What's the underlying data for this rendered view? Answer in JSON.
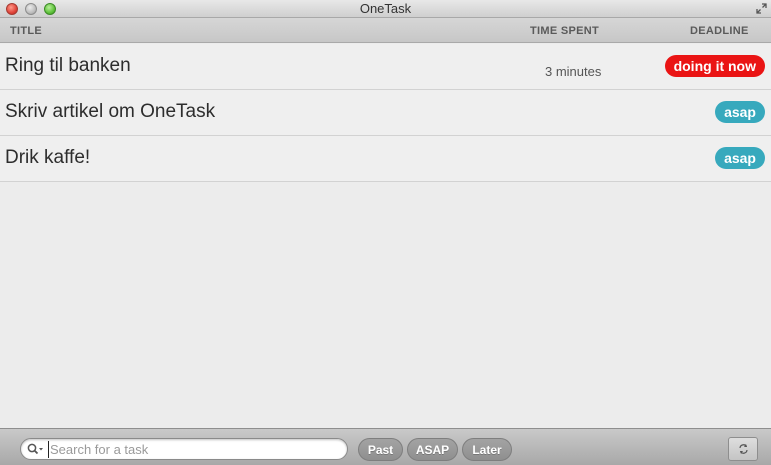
{
  "window": {
    "title": "OneTask"
  },
  "columns": {
    "title": "TITLE",
    "time_spent": "TIME SPENT",
    "deadline": "DEADLINE"
  },
  "tasks": [
    {
      "title": "Ring til banken",
      "time_spent": "3 minutes",
      "deadline": "doing it now",
      "deadline_color": "#ea1414"
    },
    {
      "title": "Skriv artikel om OneTask",
      "time_spent": "",
      "deadline": "asap",
      "deadline_color": "#37a9bd"
    },
    {
      "title": "Drik kaffe!",
      "time_spent": "",
      "deadline": "asap",
      "deadline_color": "#37a9bd"
    }
  ],
  "search": {
    "value": "",
    "placeholder": "Search for a task"
  },
  "filters": {
    "past": "Past",
    "asap": "ASAP",
    "later": "Later"
  },
  "icons": {
    "search": "search-icon",
    "sync": "sync-icon",
    "fullscreen": "fullscreen-icon"
  }
}
